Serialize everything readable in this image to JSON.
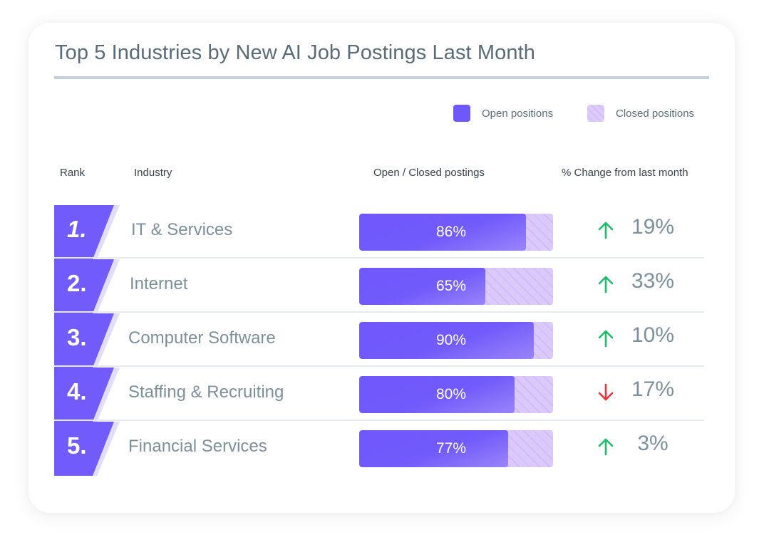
{
  "title": "Top 5 Industries by New AI Job Postings Last Month",
  "legend": {
    "open_label": "Open positions",
    "closed_label": "Closed positions",
    "open_color": "#6e58fb",
    "closed_color": "#d8c6fa"
  },
  "columns": {
    "rank": "Rank",
    "industry": "Industry",
    "postings": "Open / Closed postings",
    "change": "% Change from last month"
  },
  "colors": {
    "up": "#1fba6c",
    "down": "#e8343a"
  },
  "chart_data": {
    "type": "table",
    "title": "Top 5 Industries by New AI Job Postings Last Month",
    "columns": [
      "Rank",
      "Industry",
      "Open / Closed postings",
      "% Change from last month"
    ],
    "legend": [
      "Open positions",
      "Closed positions"
    ],
    "rows": [
      {
        "rank": "1.",
        "industry": "IT & Services",
        "open_pct": 86,
        "open_label": "86%",
        "change_direction": "up",
        "change_icon": "arrow-up-icon",
        "change_label": "19%",
        "change_value": 19
      },
      {
        "rank": "2.",
        "industry": "Internet",
        "open_pct": 65,
        "open_label": "65%",
        "change_direction": "up",
        "change_icon": "arrow-up-icon",
        "change_label": "33%",
        "change_value": 33
      },
      {
        "rank": "3.",
        "industry": "Computer Software",
        "open_pct": 90,
        "open_label": "90%",
        "change_direction": "up",
        "change_icon": "arrow-up-icon",
        "change_label": "10%",
        "change_value": 10
      },
      {
        "rank": "4.",
        "industry": "Staffing & Recruiting",
        "open_pct": 80,
        "open_label": "80%",
        "change_direction": "down",
        "change_icon": "arrow-down-icon",
        "change_label": "17%",
        "change_value": -17
      },
      {
        "rank": "5.",
        "industry": "Financial Services",
        "open_pct": 77,
        "open_label": "77%",
        "change_direction": "up",
        "change_icon": "arrow-up-icon",
        "change_label": "3%",
        "change_value": 3
      }
    ]
  }
}
